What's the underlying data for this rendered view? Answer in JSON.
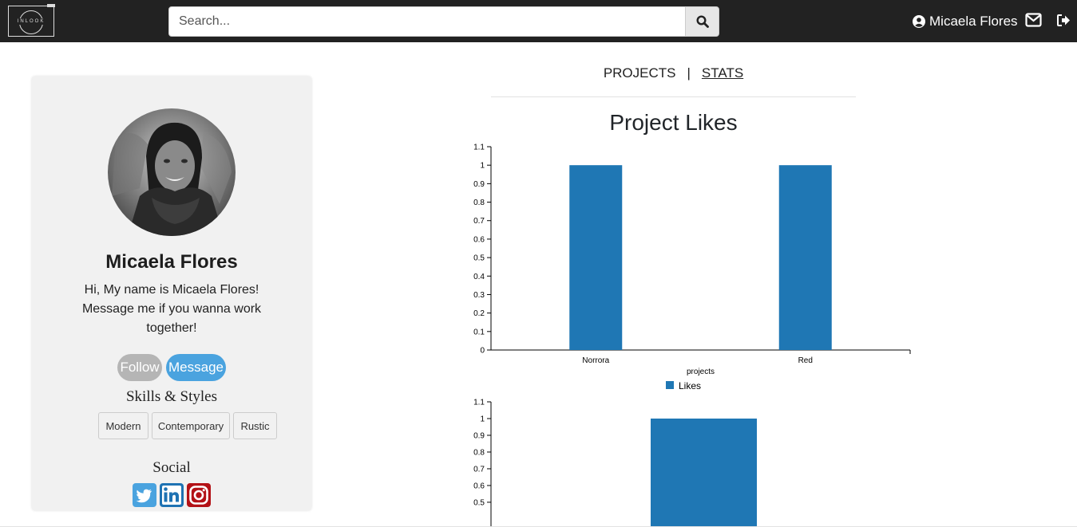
{
  "header": {
    "logo_text": "INLOOK",
    "search_placeholder": "Search...",
    "user_name": "Micaela Flores"
  },
  "profile": {
    "name": "Micaela Flores",
    "bio": "Hi, My name is Micaela Flores! Message me if you wanna work together!",
    "follow_label": "Follow",
    "message_label": "Message",
    "skills_title": "Skills & Styles",
    "skills": [
      "Modern",
      "Contemporary",
      "Rustic"
    ],
    "social_title": "Social",
    "social": [
      "twitter-icon",
      "linkedin-icon",
      "instagram-icon"
    ]
  },
  "tabs": {
    "projects_label": "PROJECTS",
    "separator": "|",
    "stats_label": "STATS"
  },
  "colors": {
    "bar": "#1f77b4",
    "follow": "#b5b5b5",
    "message": "#4aa3df",
    "topbar": "#222222"
  },
  "chart_data": [
    {
      "type": "bar",
      "title": "Project Likes",
      "categories": [
        "Norrora",
        "Red"
      ],
      "series": [
        {
          "name": "Likes",
          "values": [
            1,
            1
          ]
        }
      ],
      "xlabel": "projects",
      "ylabel": "",
      "ylim": [
        0,
        1.1
      ],
      "yticks": [
        "0",
        "0.1",
        "0.2",
        "0.3",
        "0.4",
        "0.5",
        "0.6",
        "0.7",
        "0.8",
        "0.9",
        "1",
        "1.1"
      ],
      "legend": "bottom-center",
      "grid": false
    },
    {
      "type": "bar",
      "title": "",
      "categories": [
        ""
      ],
      "series": [
        {
          "values": [
            1
          ]
        }
      ],
      "ylim": [
        0,
        1.1
      ],
      "yticks": [
        "0.5",
        "0.6",
        "0.7",
        "0.8",
        "0.9",
        "1",
        "1.1"
      ],
      "grid": false,
      "partially_visible": true
    }
  ]
}
